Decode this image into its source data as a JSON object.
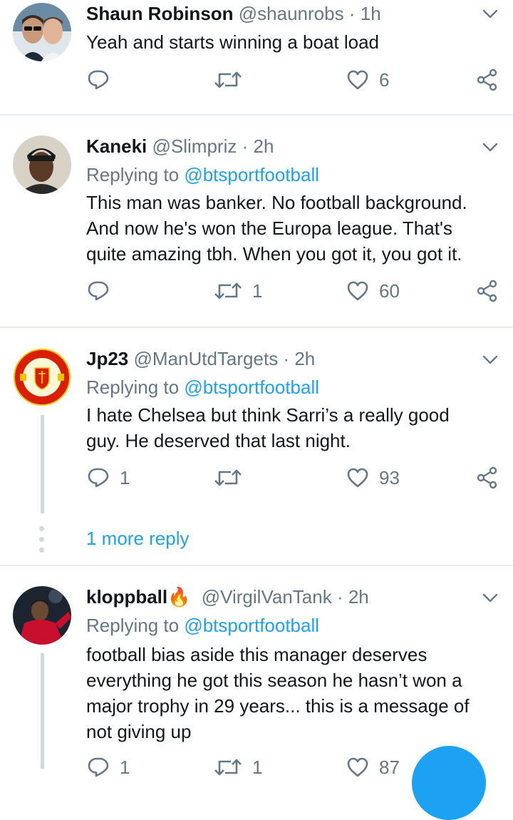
{
  "tweets": [
    {
      "name": "Shaun Robinson",
      "handle": "@shaunrobs",
      "dot": "·",
      "time": "1h",
      "replying_label": "",
      "replying_to": "",
      "text_lines": [
        "Yeah and starts winning a boat load"
      ],
      "replies": "",
      "retweets": "",
      "likes": "6"
    },
    {
      "name": "Kaneki",
      "handle": "@Slimpriz",
      "dot": "·",
      "time": "2h",
      "replying_label": "Replying to",
      "replying_to": "@btsportfootball",
      "text_lines": [
        "This man was banker. No football background.",
        "And now he's won the Europa league. That's",
        "quite amazing tbh. When you got it, you got it."
      ],
      "replies": "",
      "retweets": "1",
      "likes": "60"
    },
    {
      "name": "Jp23",
      "handle": "@ManUtdTargets",
      "dot": "·",
      "time": "2h",
      "replying_label": "Replying to",
      "replying_to": "@btsportfootball",
      "text_lines": [
        "I hate Chelsea but think Sarri’s a really good",
        "guy. He deserved that last night."
      ],
      "replies": "1",
      "retweets": "",
      "likes": "93",
      "more_replies": "1 more reply"
    },
    {
      "name": "kloppball",
      "name_emoji": "🔥",
      "handle": "@VirgilVanTank",
      "dot": "·",
      "time": "2h",
      "replying_label": "Replying to",
      "replying_to": "@btsportfootball",
      "text_lines": [
        "football bias aside this manager deserves",
        "everything he got this season he hasn’t won a",
        "major trophy in 29 years... this is a message of",
        "not giving up"
      ],
      "replies": "1",
      "retweets": "1",
      "likes": "87"
    }
  ],
  "colors": {
    "accent": "#1da1f2",
    "muted": "#657786",
    "text": "#14171a",
    "divider": "#e6ecf0"
  },
  "icons": [
    "reply-icon",
    "retweet-icon",
    "like-icon",
    "share-icon",
    "chevron-down-icon"
  ]
}
